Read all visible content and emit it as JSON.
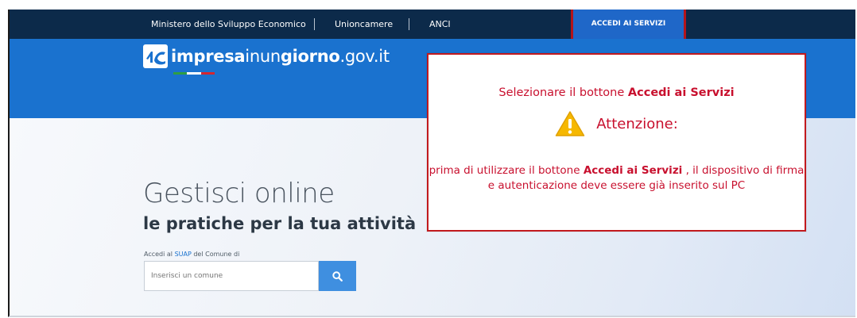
{
  "topbar": {
    "links": [
      "Ministero dello Sviluppo Economico",
      "Unioncamere",
      "ANCI"
    ],
    "accedi_button": "ACCEDI AI SERVIZI"
  },
  "logo": {
    "part_bold1": "impresa",
    "part_light": "inun",
    "part_bold2": "giorno",
    "part_domain": ".gov.it"
  },
  "hero": {
    "title": "Gestisci online",
    "subtitle": "le pratiche per la tua attività"
  },
  "search": {
    "label_prefix": "Accedi al ",
    "label_link": "SUAP",
    "label_suffix": " del Comune di",
    "placeholder": "Inserisci un comune"
  },
  "callout": {
    "line1_prefix": "Selezionare il bottone ",
    "line1_bold": "Accedi ai Servizi",
    "warning_label": "Attenzione:",
    "msg_prefix": "prima di utilizzare il bottone ",
    "msg_bold": "Accedi ai Servizi",
    "msg_suffix": " , il dispositivo di firma e autenticazione deve essere già inserito sul PC"
  },
  "icons": {
    "search": "search-icon",
    "warning": "warning-icon",
    "logo": "logo-mark-icon"
  },
  "colors": {
    "topbar": "#0c2a4a",
    "hero": "#1a72cf",
    "highlight_border": "#c21a1e",
    "callout_text": "#c8102e",
    "search_button": "#3f8fe0"
  }
}
